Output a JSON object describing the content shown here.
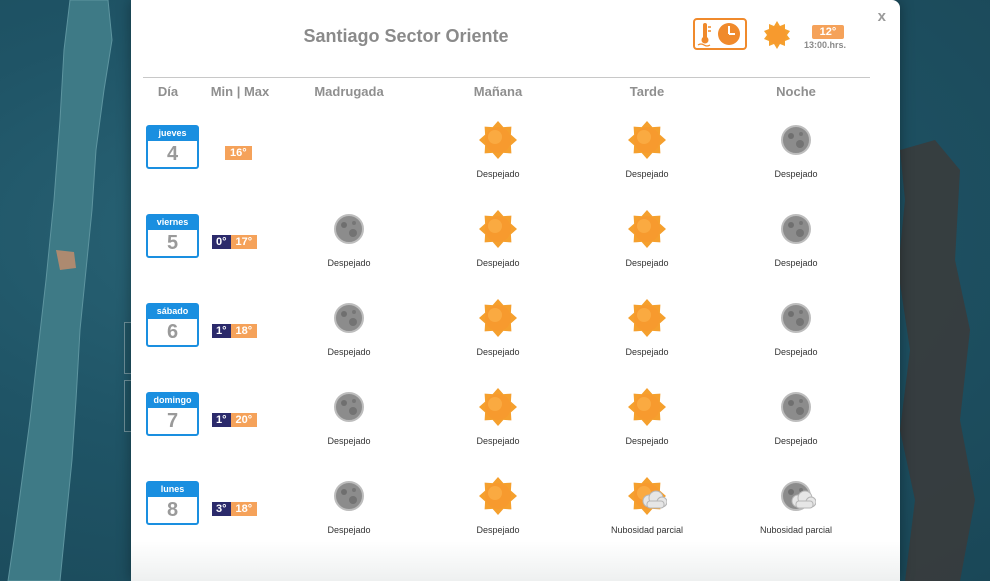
{
  "modal": {
    "title": "Santiago Sector Oriente",
    "close_label": "x",
    "current": {
      "icon": "sun-icon",
      "temp": "12°",
      "time": "13:00.hrs."
    }
  },
  "headers": {
    "dia": "Día",
    "minmax": "Min | Max",
    "madrugada": "Madrugada",
    "manana": "Mañana",
    "tarde": "Tarde",
    "noche": "Noche"
  },
  "colors": {
    "accent_blue": "#1a8fe0",
    "min_badge": "#2b2a6b",
    "max_badge": "#f5a25a",
    "sun": "#f79a2e",
    "moon": "#8a8a8a"
  },
  "days": [
    {
      "day": "jueves",
      "num": "4",
      "min": "",
      "max": "16°",
      "periods": [
        {
          "icon": "",
          "label": ""
        },
        {
          "icon": "sun",
          "label": "Despejado"
        },
        {
          "icon": "sun",
          "label": "Despejado"
        },
        {
          "icon": "moon",
          "label": "Despejado"
        }
      ]
    },
    {
      "day": "viernes",
      "num": "5",
      "min": "0°",
      "max": "17°",
      "periods": [
        {
          "icon": "moon",
          "label": "Despejado"
        },
        {
          "icon": "sun",
          "label": "Despejado"
        },
        {
          "icon": "sun",
          "label": "Despejado"
        },
        {
          "icon": "moon",
          "label": "Despejado"
        }
      ]
    },
    {
      "day": "sábado",
      "num": "6",
      "min": "1°",
      "max": "18°",
      "periods": [
        {
          "icon": "moon",
          "label": "Despejado"
        },
        {
          "icon": "sun",
          "label": "Despejado"
        },
        {
          "icon": "sun",
          "label": "Despejado"
        },
        {
          "icon": "moon",
          "label": "Despejado"
        }
      ]
    },
    {
      "day": "domingo",
      "num": "7",
      "min": "1°",
      "max": "20°",
      "periods": [
        {
          "icon": "moon",
          "label": "Despejado"
        },
        {
          "icon": "sun",
          "label": "Despejado"
        },
        {
          "icon": "sun",
          "label": "Despejado"
        },
        {
          "icon": "moon",
          "label": "Despejado"
        }
      ]
    },
    {
      "day": "lunes",
      "num": "8",
      "min": "3°",
      "max": "18°",
      "periods": [
        {
          "icon": "moon",
          "label": "Despejado"
        },
        {
          "icon": "sun",
          "label": "Despejado"
        },
        {
          "icon": "sun-cloud",
          "label": "Nubosidad parcial"
        },
        {
          "icon": "moon-cloud",
          "label": "Nubosidad parcial"
        }
      ]
    }
  ]
}
